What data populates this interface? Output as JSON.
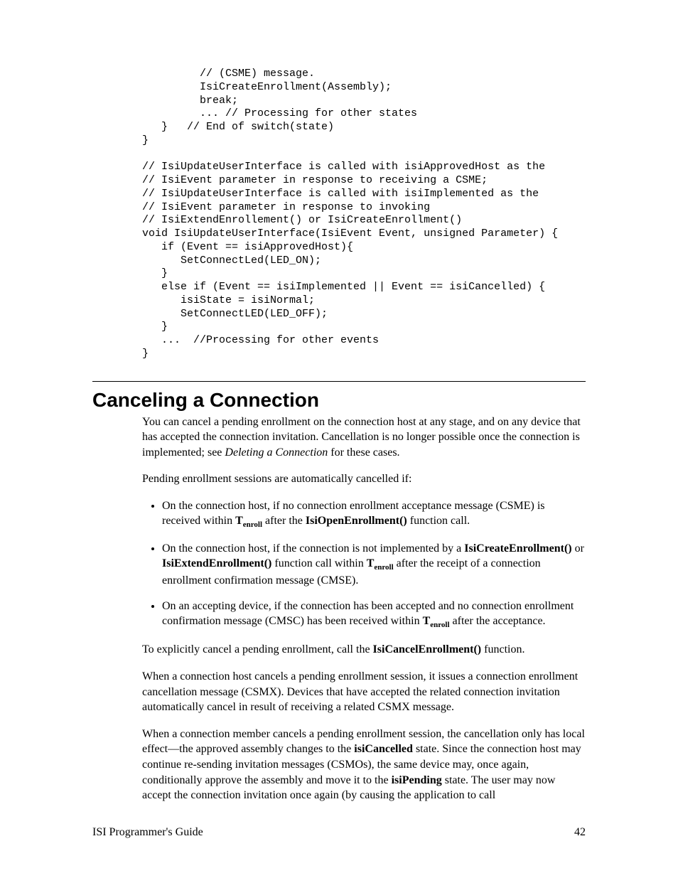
{
  "code": "         // (CSME) message.\n         IsiCreateEnrollment(Assembly);\n         break;\n         ... // Processing for other states\n   }   // End of switch(state)\n}\n\n// IsiUpdateUserInterface is called with isiApprovedHost as the\n// IsiEvent parameter in response to receiving a CSME;\n// IsiUpdateUserInterface is called with isiImplemented as the\n// IsiEvent parameter in response to invoking\n// IsiExtendEnrollement() or IsiCreateEnrollment()\nvoid IsiUpdateUserInterface(IsiEvent Event, unsigned Parameter) {\n   if (Event == isiApprovedHost){\n      SetConnectLed(LED_ON);\n   }\n   else if (Event == isiImplemented || Event == isiCancelled) {\n      isiState = isiNormal;\n      SetConnectLED(LED_OFF);\n   }\n   ...  //Processing for other events\n}",
  "heading": "Canceling a Connection",
  "p1a": "You can cancel a pending enrollment on the connection host at any stage, and on any device that has accepted the connection invitation.  Cancellation is no longer possible once the connection is implemented; see ",
  "p1_em": "Deleting a Connection",
  "p1b": " for these cases.",
  "p2": "Pending enrollment sessions are automatically cancelled if:",
  "li1a": "On the connection host, if no connection enrollment acceptance message (CSME) is received within ",
  "li1_t": "T",
  "li1_sub": "enroll",
  "li1b": " after the ",
  "li1_fn": "IsiOpenEnrollment()",
  "li1c": " function call.",
  "li2a": "On the connection host, if the connection is not implemented by a ",
  "li2_fn1": "IsiCreateEnrollment()",
  "li2b": " or ",
  "li2_fn2": "IsiExtendEnrollment()",
  "li2c": " function call within ",
  "li2_t": "T",
  "li2_sub": "enroll",
  "li2d": " after the receipt of a connection enrollment confirmation  message (CMSE).",
  "li3a": "On an accepting device, if the connection has been accepted and no connection enrollment confirmation message (CMSC) has been received within ",
  "li3_t": "T",
  "li3_sub": "enroll",
  "li3b": " after the acceptance.",
  "p3a": "To explicitly cancel a pending enrollment, call the ",
  "p3_fn": "IsiCancelEnrollment()",
  "p3b": " function.",
  "p4": "When a connection host cancels a pending enrollment session, it issues a connection enrollment cancellation message (CSMX).  Devices that have accepted the related connection invitation automatically cancel in result of receiving a related CSMX message.",
  "p5a": "When a connection member cancels a pending enrollment session, the cancellation only has local effect—the approved assembly changes to the ",
  "p5_s1": "isiCancelled",
  "p5b": " state.  Since the connection host may continue re-sending invitation messages (CSMOs), the same device may, once again, conditionally approve the assembly and move it to the ",
  "p5_s2": "isiPending",
  "p5c": " state.  The user may now accept the connection invitation once again (by causing the application to call",
  "footer_left": "ISI Programmer's Guide",
  "footer_right": "42"
}
